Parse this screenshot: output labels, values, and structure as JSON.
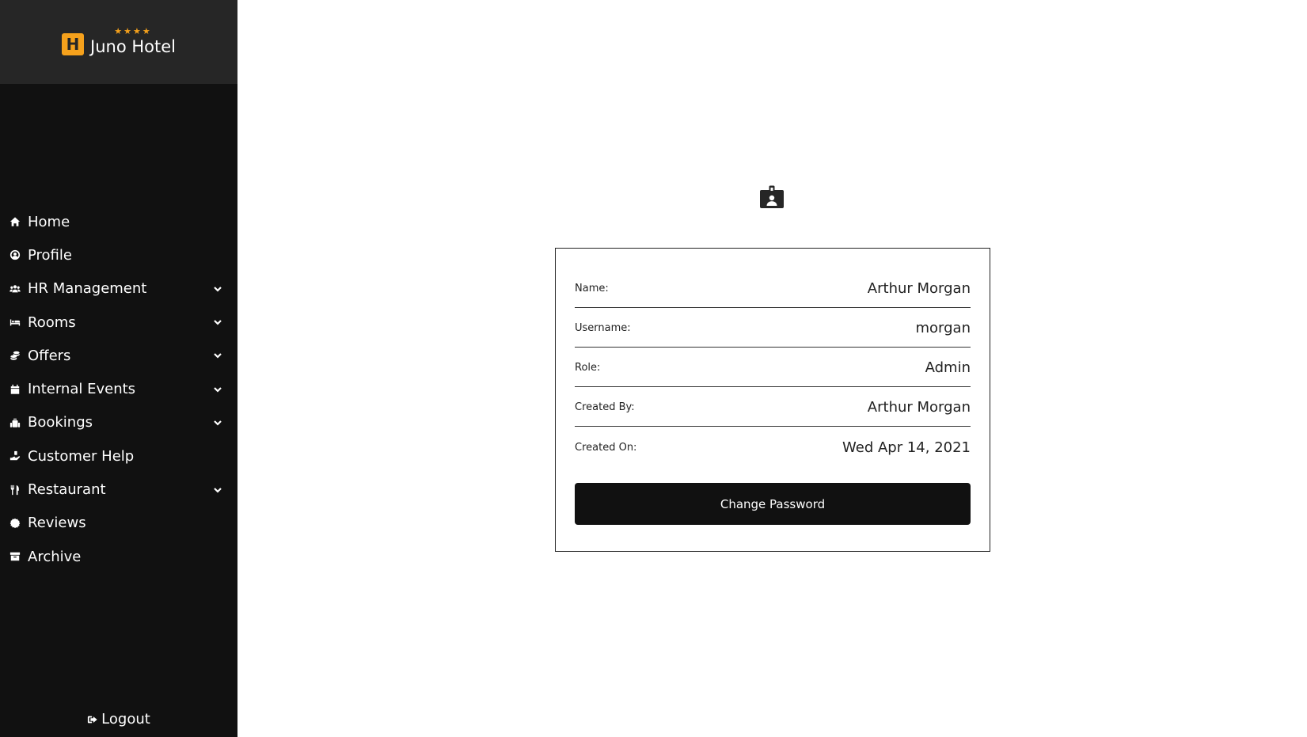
{
  "brand": {
    "stars": "★★★★",
    "name": "Juno Hotel",
    "logo_letter": "H",
    "accent_color": "#f5a11c"
  },
  "sidebar": {
    "items": [
      {
        "label": "Home",
        "icon": "home-icon",
        "has_chevron": false
      },
      {
        "label": "Profile",
        "icon": "user-circle-icon",
        "has_chevron": false
      },
      {
        "label": "HR Management",
        "icon": "users-icon",
        "has_chevron": true
      },
      {
        "label": "Rooms",
        "icon": "bed-icon",
        "has_chevron": true
      },
      {
        "label": "Offers",
        "icon": "coins-icon",
        "has_chevron": true
      },
      {
        "label": "Internal Events",
        "icon": "calendar-icon",
        "has_chevron": true
      },
      {
        "label": "Bookings",
        "icon": "luggage-icon",
        "has_chevron": true
      },
      {
        "label": "Customer Help",
        "icon": "hand-holding-icon",
        "has_chevron": false
      },
      {
        "label": "Restaurant",
        "icon": "utensils-icon",
        "has_chevron": true
      },
      {
        "label": "Reviews",
        "icon": "badge-icon",
        "has_chevron": false
      },
      {
        "label": "Archive",
        "icon": "archive-icon",
        "has_chevron": false
      }
    ],
    "logout_label": "Logout"
  },
  "profile": {
    "header_icon": "id-badge-icon",
    "fields": [
      {
        "label": "Name:",
        "value": "Arthur Morgan"
      },
      {
        "label": "Username:",
        "value": "morgan"
      },
      {
        "label": "Role:",
        "value": "Admin"
      },
      {
        "label": "Created By:",
        "value": "Arthur Morgan"
      },
      {
        "label": "Created On:",
        "value": "Wed Apr 14, 2021"
      }
    ],
    "change_password_label": "Change Password"
  }
}
